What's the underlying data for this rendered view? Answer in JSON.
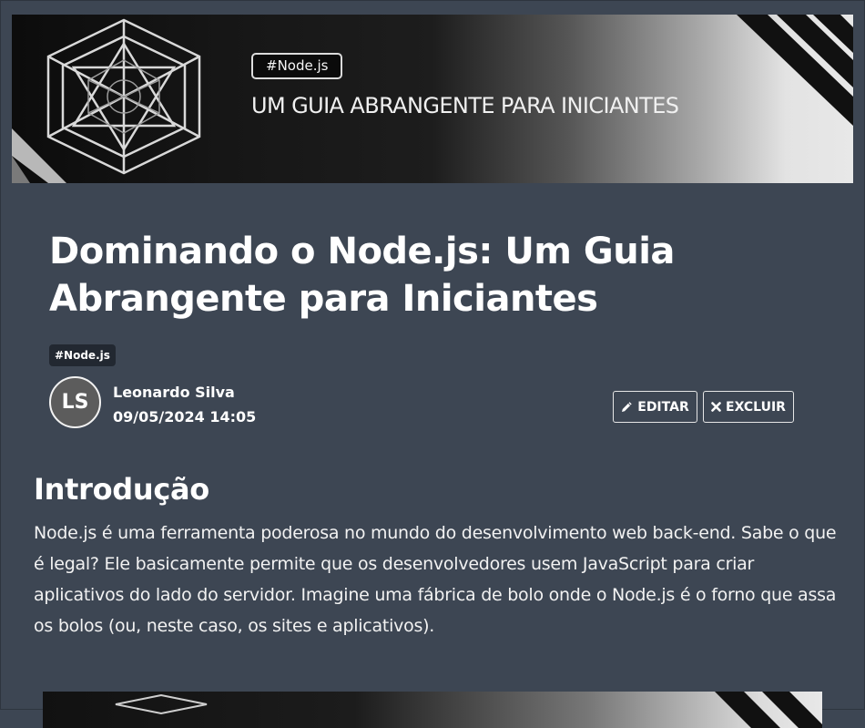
{
  "banner": {
    "tag": "#Node.js",
    "subtitle": "UM GUIA ABRANGENTE PARA INICIANTES",
    "logo_icon": "wireframe-cube-logo"
  },
  "post": {
    "title": "Dominando o Node.js: Um Guia Abrangente para Iniciantes",
    "tag": "#Node.js"
  },
  "author": {
    "initials": "LS",
    "name": "Leonardo Silva",
    "date": "09/05/2024 14:05"
  },
  "actions": {
    "edit_label": "EDITAR",
    "edit_icon": "pencil-icon",
    "delete_label": "EXCLUIR",
    "delete_icon": "close-icon"
  },
  "content": {
    "heading": "Introdução",
    "paragraph": "Node.js é uma ferramenta poderosa no mundo do desenvolvimento web back-end. Sabe o que é legal? Ele basicamente permite que os desenvolvedores usem JavaScript para criar aplicativos do lado do servidor. Imagine uma fábrica de bolo onde o Node.js é o forno que assa os bolos (ou, neste caso, os sites e aplicativos)."
  },
  "colors": {
    "background": "#3d4653",
    "text": "#ffffff",
    "chip": "#222831"
  }
}
